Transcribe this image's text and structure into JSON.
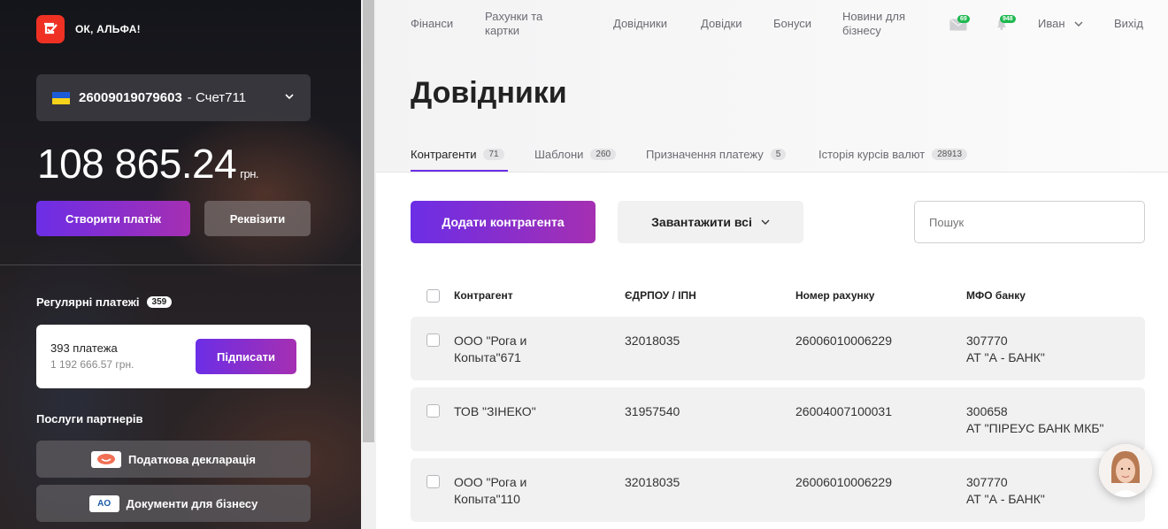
{
  "brand": {
    "logo_text": "ОК, АЛЬФА!",
    "accent_color": "#ef3124"
  },
  "account": {
    "number": "26009019079603",
    "name": "- Счет711",
    "balance": "108 865.24",
    "currency": "грн."
  },
  "sidebar": {
    "create_payment": "Створити платіж",
    "requisites": "Реквізити",
    "regular": {
      "title": "Регулярні платежі",
      "count": "359",
      "items_count": "393 платежа",
      "sum": "1 192 666.57 грн.",
      "sign_label": "Підписати"
    },
    "partners": {
      "title": "Послуги партнерів",
      "items": [
        "Податкова декларація",
        "Документи для бізнесу"
      ],
      "icon2_text": "AO"
    }
  },
  "nav": {
    "items": [
      "Фінанси",
      "Рахунки та\nкартки",
      "Довідники",
      "Довідки",
      "Бонуси",
      "Новини для\nбізнесу"
    ],
    "mail_count": "69",
    "notif_count": "948",
    "user": "Иван",
    "logout": "Вихід"
  },
  "page": {
    "title": "Довідники"
  },
  "tabs": [
    {
      "label": "Контрагенти",
      "count": "71"
    },
    {
      "label": "Шаблони",
      "count": "260"
    },
    {
      "label": "Призначення платежу",
      "count": "5"
    },
    {
      "label": "Історія курсів валют",
      "count": "28913"
    }
  ],
  "actions": {
    "add": "Додати контрагента",
    "load_all": "Завантажити всі",
    "search_placeholder": "Пошук"
  },
  "table": {
    "headers": [
      "Контрагент",
      "ЄДРПОУ / ІПН",
      "Номер рахунку",
      "МФО банку"
    ],
    "rows": [
      {
        "name": "ООО \"Рога и\nКопыта\"671",
        "code": "32018035",
        "account": "26006010006229",
        "mfo": "307770\nАТ \"А - БАНК\""
      },
      {
        "name": "ТОВ \"ЗІНЕКО\"",
        "code": "31957540",
        "account": "26004007100031",
        "mfo": "300658\nАТ \"ПІРЕУС БАНК МКБ\""
      },
      {
        "name": "ООО \"Рога и\nКопыта\"110",
        "code": "32018035",
        "account": "26006010006229",
        "mfo": "307770\nАТ \"А - БАНК\""
      }
    ]
  }
}
